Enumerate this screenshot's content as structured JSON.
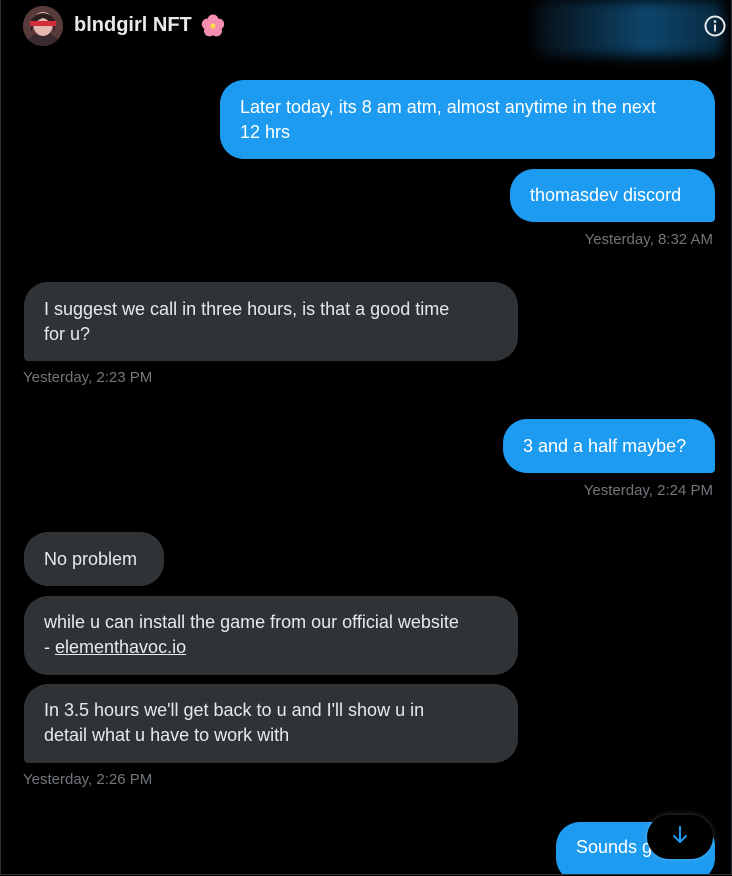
{
  "header": {
    "contact_name": "blndgirl NFT",
    "name_emoji": "hibiscus-flower-icon",
    "info_icon": "info-circle-icon"
  },
  "colors": {
    "outgoing_bubble": "#1d9bf0",
    "incoming_bubble": "#2f3336",
    "timestamp": "#71767b",
    "background": "#000000"
  },
  "messages": [
    {
      "direction": "out",
      "text_lines": [
        "Later today, its 8 am atm, almost anytime in the next",
        "12 hrs"
      ]
    },
    {
      "direction": "out",
      "text_lines": [
        "thomasdev discord"
      ]
    },
    {
      "timestamp": "Yesterday, 8:32 AM"
    },
    {
      "direction": "in",
      "text_lines": [
        "I suggest we call in three hours, is that a good time",
        "for u?"
      ]
    },
    {
      "timestamp": "Yesterday, 2:23 PM"
    },
    {
      "direction": "out",
      "text_lines": [
        "3 and a half maybe?"
      ]
    },
    {
      "timestamp": "Yesterday, 2:24 PM"
    },
    {
      "direction": "in",
      "text_lines": [
        "No problem"
      ]
    },
    {
      "direction": "in",
      "text_lines": [
        "while u can install the game from our official website",
        "- "
      ],
      "link": "elementhavoc.io"
    },
    {
      "direction": "in",
      "text_lines": [
        "In 3.5 hours we'll get back to u and I'll show u in",
        "detail what u have to work with"
      ]
    },
    {
      "timestamp": "Yesterday, 2:26 PM"
    },
    {
      "direction": "out",
      "text_lines": [
        "Sounds g"
      ]
    }
  ],
  "scroll_button": {
    "icon": "arrow-down-icon"
  }
}
